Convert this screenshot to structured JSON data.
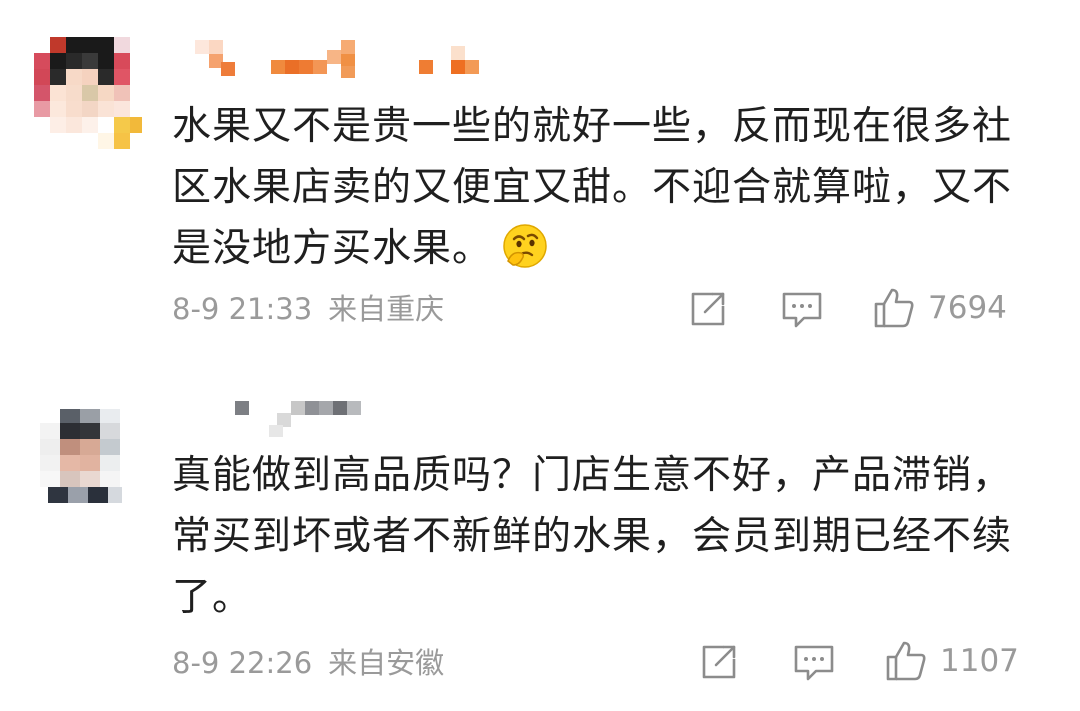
{
  "comments": [
    {
      "text": "水果又不是贵一些的就好一些，反而现在很多社区水果店卖的又便宜又甜。不迎合就算啦，又不是没地方买水果。",
      "emoji": "thinking-face-emoji",
      "time": "8-9 21:33",
      "location": "来自重庆",
      "likes": "7694"
    },
    {
      "text": "真能做到高品质吗？门店生意不好，产品滞销，常买到坏或者不新鲜的水果，会员到期已经不续了。",
      "time": "8-9 22:26",
      "location": "来自安徽",
      "likes": "1107"
    }
  ],
  "icons": {
    "share": "share-icon",
    "reply": "comment-icon",
    "like": "thumbs-up-icon"
  },
  "colors": {
    "text": "#1f1f1f",
    "meta": "#9a9a9a",
    "icon": "#8c8c8c"
  }
}
